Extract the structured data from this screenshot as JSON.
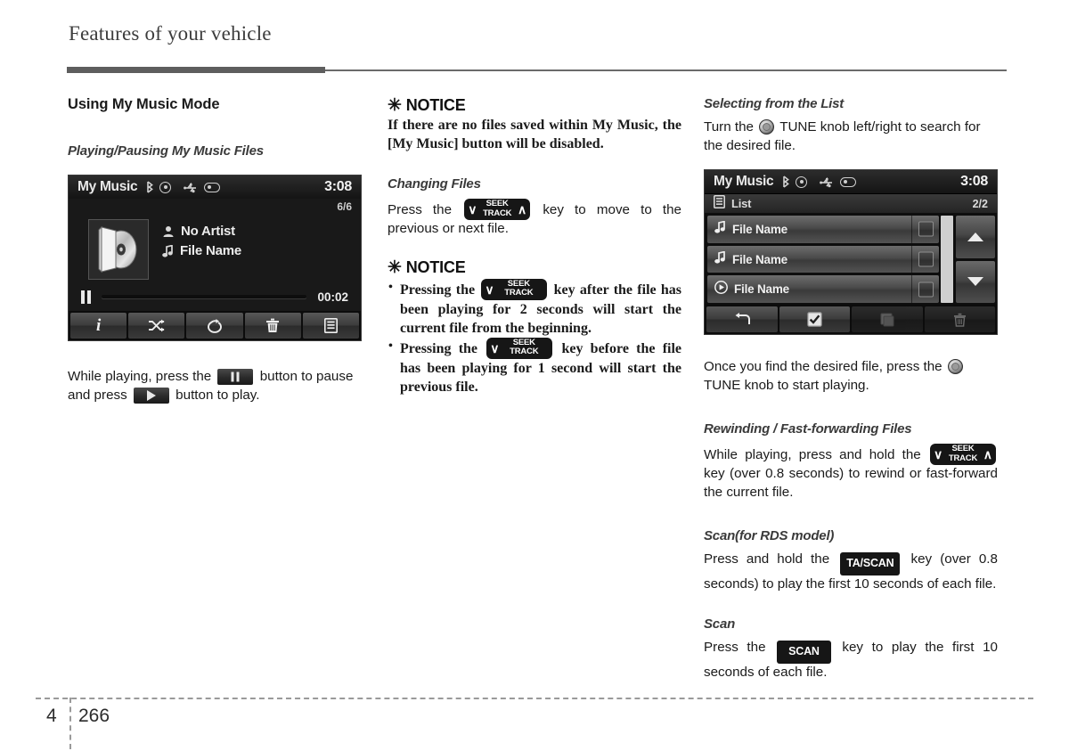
{
  "header": {
    "title": "Features of your vehicle"
  },
  "footer": {
    "chapter": "4",
    "page": "266"
  },
  "column1": {
    "section_title": "Using My Music Mode",
    "subsection_title": "Playing/Pausing My Music Files",
    "player_screen": {
      "title": "My Music",
      "icons": [
        "bluetooth-icon",
        "disc-icon",
        "usb-icon",
        "ipod-icon"
      ],
      "clock": "3:08",
      "track_counter": "6/6",
      "artist": "No Artist",
      "file_name": "File Name",
      "elapsed_time": "00:02",
      "state": "paused",
      "toolbar_icons": [
        "info-icon",
        "shuffle-icon",
        "repeat-icon",
        "trash-icon",
        "list-icon"
      ]
    },
    "paragraph_part1": "While playing, press the",
    "paragraph_part2": "button to pause and press",
    "paragraph_part3": "button to play."
  },
  "column2": {
    "notice1": {
      "star": "✳",
      "heading": "NOTICE",
      "body": "If there are no files saved within My Music, the [My Music] button will be disabled."
    },
    "changing_files": {
      "title": "Changing Files",
      "text_before": "Press the",
      "key_label_top": "SEEK",
      "key_label_bottom": "TRACK",
      "text_after": "key to move to the previous or next file."
    },
    "notice2": {
      "star": "✳",
      "heading": "NOTICE",
      "items": [
        {
          "before": "Pressing the",
          "after": "key after the file has been playing for 2 seconds will start the current file from the beginning."
        },
        {
          "before": "Pressing the",
          "after": "key before the file has been playing for 1 second will start the previous file."
        }
      ]
    }
  },
  "column3": {
    "selecting": {
      "title": "Selecting from the List",
      "text_before": "Turn the",
      "text_after": "TUNE knob left/right to search for the desired file."
    },
    "list_screen": {
      "title": "My Music",
      "icons": [
        "bluetooth-icon",
        "disc-icon",
        "usb-icon",
        "ipod-icon"
      ],
      "clock": "3:08",
      "list_label": "List",
      "page_counter": "2/2",
      "rows": [
        {
          "icon": "music-note-icon",
          "label": "File Name",
          "checked": false
        },
        {
          "icon": "music-note-icon",
          "label": "File Name",
          "checked": false
        },
        {
          "icon": "play-circle-icon",
          "label": "File Name",
          "checked": false
        }
      ],
      "scroll_up": "up-arrow-icon",
      "scroll_down": "down-arrow-icon",
      "toolbar_icons": [
        "back-icon",
        "checkbox-checked-icon",
        "copy-icon",
        "trash-icon"
      ]
    },
    "after_list": {
      "text_before": "Once you find the desired file, press the",
      "text_after": "TUNE knob to start playing."
    },
    "rewinding": {
      "title": "Rewinding / Fast-forwarding Files",
      "text_before": "While playing, press and hold the",
      "key_label_top": "SEEK",
      "key_label_bottom": "TRACK",
      "text_after": "key (over 0.8 seconds) to rewind or fast-forward the current file."
    },
    "scan_rds": {
      "title": "Scan(for RDS model)",
      "text_before": "Press and hold the",
      "key_label": "TA/SCAN",
      "text_after": "key (over 0.8 seconds) to play the first 10 seconds of each file."
    },
    "scan": {
      "title": "Scan",
      "text_before": "Press the",
      "key_label": "SCAN",
      "text_after": "key to play the first 10 seconds of each file."
    }
  }
}
